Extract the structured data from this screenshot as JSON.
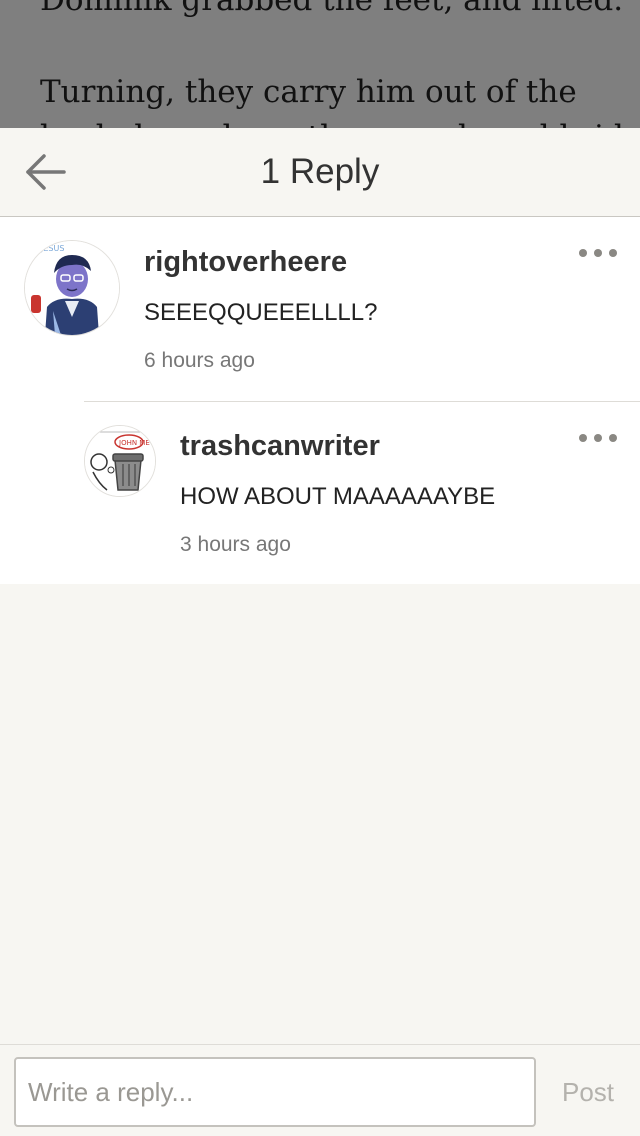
{
  "story": {
    "lines": [
      "Dominik grabbed the feet, and lifted.",
      "Turning, they carry him out of the",
      "back door, down the worn board bridge"
    ]
  },
  "header": {
    "title": "1 Reply",
    "back_icon": "arrow-left-icon"
  },
  "comments": [
    {
      "username": "rightoverheere",
      "text": "SEEEQQUEEELLLL?",
      "time": "6 hours ago",
      "avatar_icon": "avatar-image",
      "avatar_scribble": "JESUS"
    },
    {
      "username": "trashcanwriter",
      "text": "HOW ABOUT MAAAAAAYBE",
      "time": "3 hours ago",
      "avatar_icon": "avatar-image",
      "avatar_scribble": "JOHN ME"
    }
  ],
  "reply_bar": {
    "placeholder": "Write a reply...",
    "post_label": "Post"
  },
  "colors": {
    "accent_muted": "#b4b2ad",
    "text_primary": "#333333",
    "background": "#f7f6f2"
  }
}
